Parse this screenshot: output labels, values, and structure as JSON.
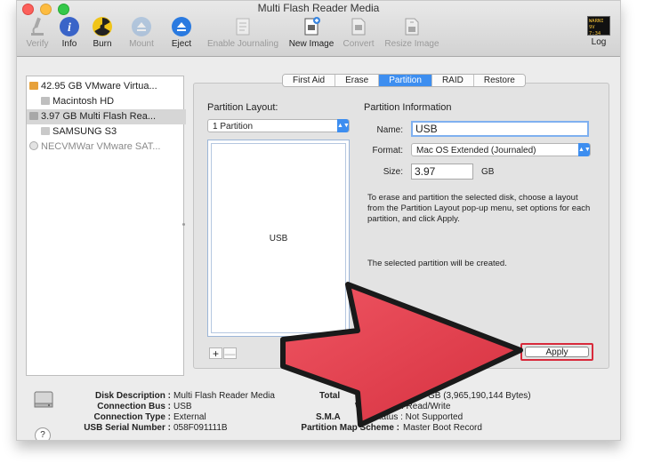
{
  "window": {
    "title": "Multi Flash Reader Media"
  },
  "toolbar": {
    "verify": "Verify",
    "info": "Info",
    "burn": "Burn",
    "mount": "Mount",
    "eject": "Eject",
    "enable_journaling": "Enable Journaling",
    "new_image": "New Image",
    "convert": "Convert",
    "resize_image": "Resize Image",
    "log": "Log",
    "log_badge_line1": "WARNI",
    "log_badge_line2": "9V 7:34"
  },
  "sidebar": {
    "items": [
      {
        "label": "42.95 GB VMware Virtua..."
      },
      {
        "label": "Macintosh HD"
      },
      {
        "label": "3.97 GB Multi Flash Rea..."
      },
      {
        "label": "SAMSUNG S3"
      },
      {
        "label": "NECVMWar VMware SAT..."
      }
    ]
  },
  "tabs": [
    "First Aid",
    "Erase",
    "Partition",
    "RAID",
    "Restore"
  ],
  "partition_layout": {
    "label": "Partition Layout:",
    "selected": "1 Partition",
    "partition_name": "USB",
    "add": "+",
    "remove": "—"
  },
  "partition_info": {
    "heading": "Partition Information",
    "name_label": "Name:",
    "name_value": "USB",
    "format_label": "Format:",
    "format_value": "Mac OS Extended (Journaled)",
    "size_label": "Size:",
    "size_value": "3.97",
    "size_unit": "GB",
    "instructions": "To erase and partition the selected disk, choose a layout from the Partition Layout pop-up menu, set options for each partition, and click Apply.",
    "status": "The selected partition will be created.",
    "apply": "Apply"
  },
  "info": {
    "disk_description_key": "Disk Description :",
    "disk_description_val": "Multi Flash Reader Media",
    "connection_bus_key": "Connection Bus :",
    "connection_bus_val": "USB",
    "connection_type_key": "Connection Type :",
    "connection_type_val": "External",
    "serial_key": "USB Serial Number :",
    "serial_val": "058F091111B",
    "total_key": "Total",
    "total_val": "GB (3,965,190,144 Bytes)",
    "write_key": "W",
    "write_val": ": Read/Write",
    "smart_key": "S.M.A",
    "smart_val": "Status : Not Supported",
    "pms_key": "Partition Map Scheme :",
    "pms_val": "Master Boot Record"
  },
  "help": "?",
  "colors": {
    "accent": "#3d8ef0",
    "arrow": "#e23a48",
    "apply_highlight": "#d82a3b"
  }
}
